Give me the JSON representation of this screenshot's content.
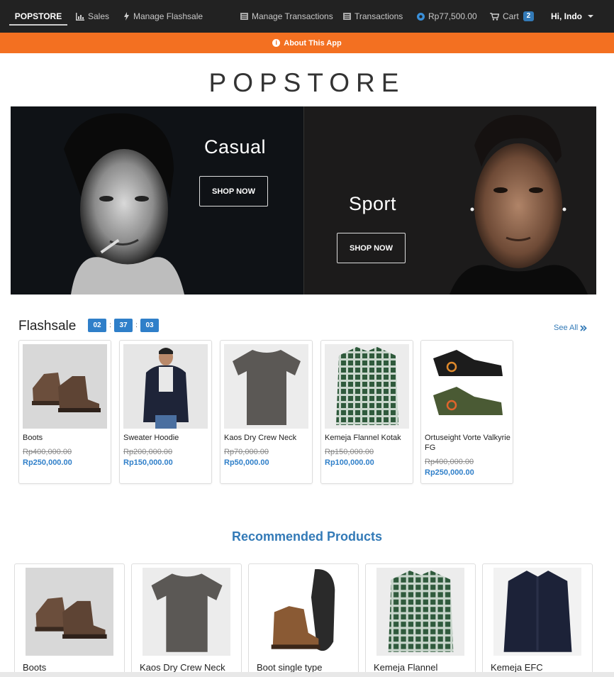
{
  "navbar": {
    "brand": "POPSTORE",
    "items": [
      {
        "label": "Sales",
        "icon": "bar-chart-icon"
      },
      {
        "label": "Manage Flashsale",
        "icon": "flash-icon"
      },
      {
        "label": "Manage Transactions",
        "icon": "list-icon"
      },
      {
        "label": "Transactions",
        "icon": "list-icon"
      },
      {
        "label": "Rp77,500.00",
        "icon": "coin-icon"
      },
      {
        "label": "Cart",
        "icon": "cart-icon"
      }
    ],
    "cart_count": "2",
    "user_greeting": "Hi, Indo"
  },
  "about_bar": {
    "label": "About This App"
  },
  "store_title": "POPSTORE",
  "hero": {
    "casual": {
      "heading": "Casual",
      "button": "SHOP NOW"
    },
    "sport": {
      "heading": "Sport",
      "button": "SHOP NOW"
    }
  },
  "flashsale": {
    "title": "Flashsale",
    "timer": {
      "hours": "02",
      "minutes": "37",
      "seconds": "03",
      "separator": ":"
    },
    "see_all": "See All",
    "products": [
      {
        "name": "Boots",
        "old_price": "Rp400,000.00",
        "price": "Rp250,000.00"
      },
      {
        "name": "Sweater Hoodie",
        "old_price": "Rp200,000.00",
        "price": "Rp150,000.00"
      },
      {
        "name": "Kaos Dry Crew Neck",
        "old_price": "Rp70,000.00",
        "price": "Rp50,000.00"
      },
      {
        "name": "Kemeja Flannel Kotak",
        "old_price": "Rp150,000.00",
        "price": "Rp100,000.00"
      },
      {
        "name": "Ortuseight Vorte Valkyrie FG",
        "old_price": "Rp400,000.00",
        "price": "Rp250,000.00"
      }
    ]
  },
  "recommended": {
    "title": "Recommended Products",
    "products": [
      {
        "name": "Boots"
      },
      {
        "name": "Kaos Dry Crew Neck"
      },
      {
        "name": "Boot single type"
      },
      {
        "name": "Kemeja Flannel"
      },
      {
        "name": "Kemeja EFC"
      }
    ]
  },
  "colors": {
    "navbar": "#222222",
    "accent_orange": "#f37021",
    "link_blue": "#337ab7",
    "price_blue": "#2f7fc9"
  }
}
